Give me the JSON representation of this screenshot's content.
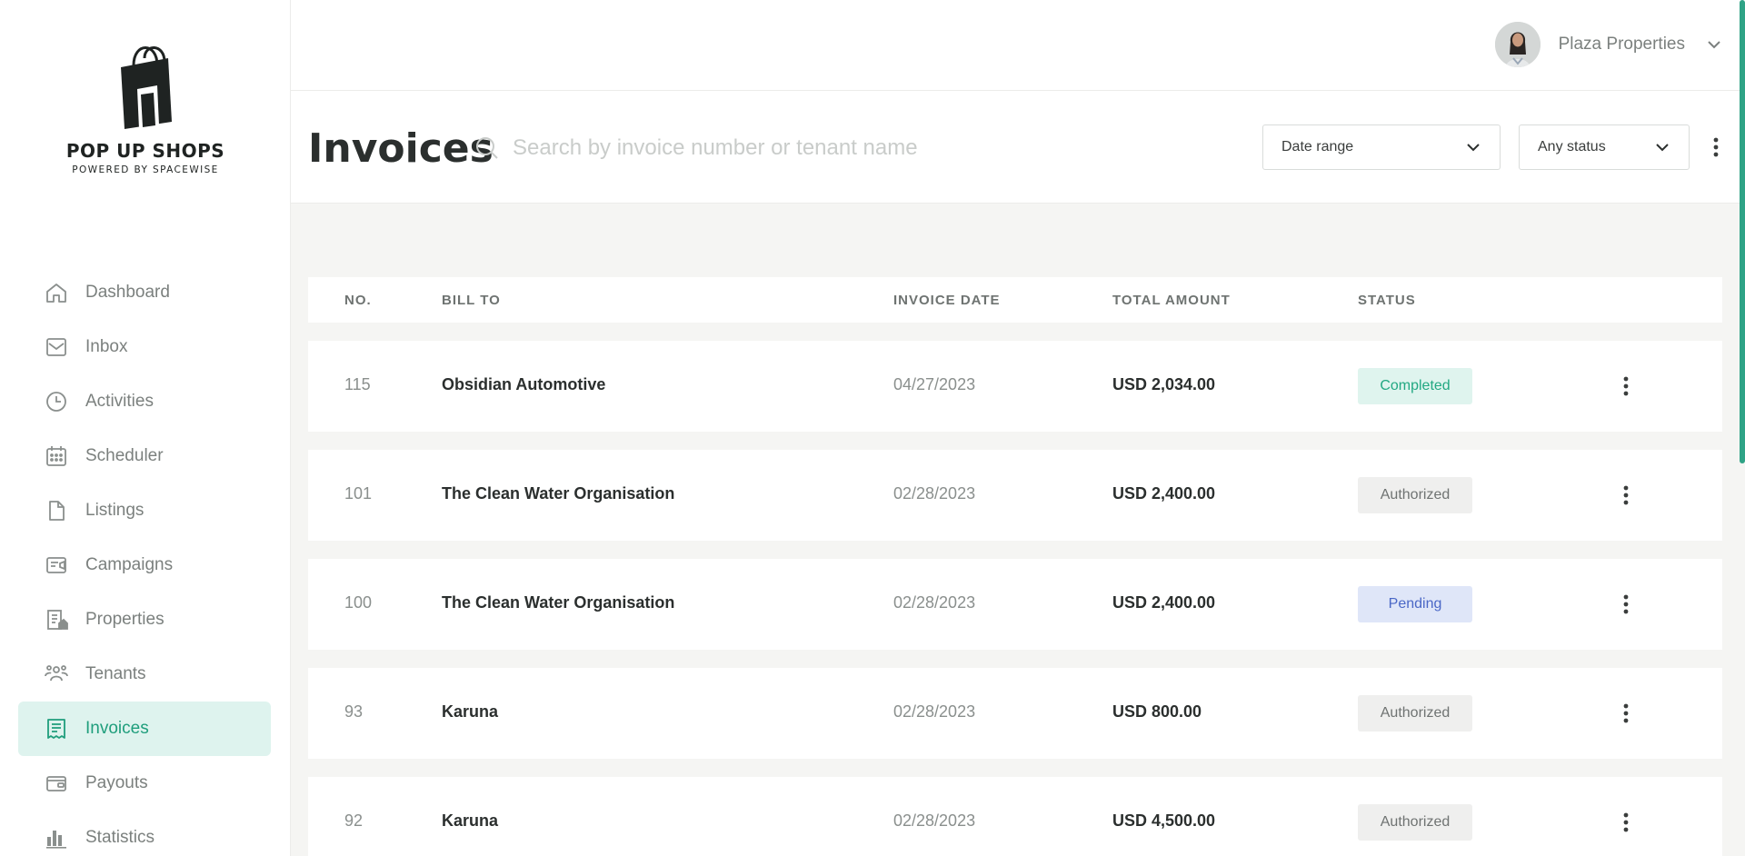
{
  "brand": {
    "title": "POP UP SHOPS",
    "subtitle": "POWERED BY SPACEWISE"
  },
  "sidebar": {
    "items": [
      {
        "label": "Dashboard",
        "icon": "home-icon"
      },
      {
        "label": "Inbox",
        "icon": "mail-icon"
      },
      {
        "label": "Activities",
        "icon": "clock-icon"
      },
      {
        "label": "Scheduler",
        "icon": "calendar-icon"
      },
      {
        "label": "Listings",
        "icon": "document-icon"
      },
      {
        "label": "Campaigns",
        "icon": "campaign-icon"
      },
      {
        "label": "Properties",
        "icon": "building-icon"
      },
      {
        "label": "Tenants",
        "icon": "people-icon"
      },
      {
        "label": "Invoices",
        "icon": "receipt-icon",
        "active": true
      },
      {
        "label": "Payouts",
        "icon": "wallet-icon"
      },
      {
        "label": "Statistics",
        "icon": "bar-chart-icon"
      }
    ]
  },
  "account": {
    "name": "Plaza Properties"
  },
  "header": {
    "title": "Invoices",
    "search_placeholder": "Search by invoice number or tenant name",
    "date_filter": "Date range",
    "status_filter": "Any status"
  },
  "table": {
    "columns": [
      "NO.",
      "BILL TO",
      "INVOICE DATE",
      "TOTAL AMOUNT",
      "STATUS"
    ],
    "rows": [
      {
        "no": "115",
        "bill_to": "Obsidian Automotive",
        "date": "04/27/2023",
        "amount": "USD 2,034.00",
        "status": "Completed"
      },
      {
        "no": "101",
        "bill_to": "The Clean Water Organisation",
        "date": "02/28/2023",
        "amount": "USD 2,400.00",
        "status": "Authorized"
      },
      {
        "no": "100",
        "bill_to": "The Clean Water Organisation",
        "date": "02/28/2023",
        "amount": "USD 2,400.00",
        "status": "Pending"
      },
      {
        "no": "93",
        "bill_to": "Karuna",
        "date": "02/28/2023",
        "amount": "USD 800.00",
        "status": "Authorized"
      },
      {
        "no": "92",
        "bill_to": "Karuna",
        "date": "02/28/2023",
        "amount": "USD 4,500.00",
        "status": "Authorized"
      }
    ]
  },
  "colors": {
    "accent": "#1f9e7c",
    "active_nav_bg": "#def3ee",
    "completed": "#22a882",
    "pending": "#4a67c6",
    "authorized": "#6f7372"
  }
}
